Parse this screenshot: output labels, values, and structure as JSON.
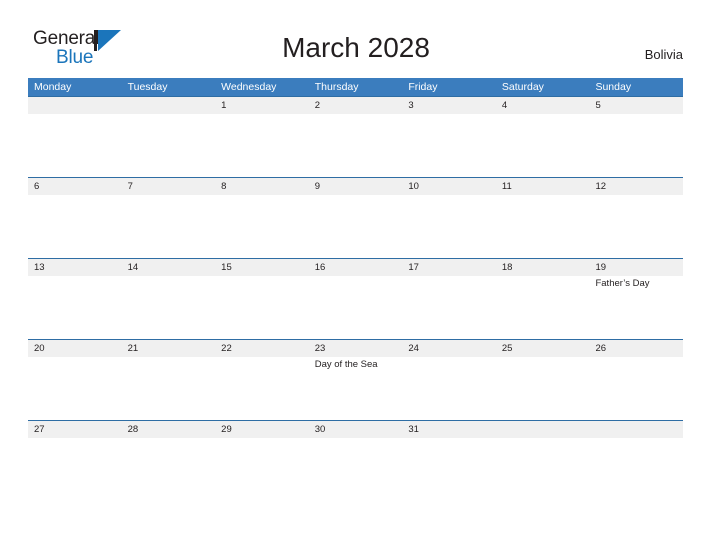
{
  "brand": {
    "word1": "General",
    "word2": "Blue",
    "logo_icon": "general-blue-triangle-logo",
    "accent_color": "#1b75bb",
    "text_color": "#231f20"
  },
  "header": {
    "title": "March 2028",
    "region": "Bolivia"
  },
  "calendar": {
    "header_bg_color": "#3b7dbe",
    "band_color": "#f0f0f0",
    "row_border_color": "#2e6da4",
    "weekdays": [
      "Monday",
      "Tuesday",
      "Wednesday",
      "Thursday",
      "Friday",
      "Saturday",
      "Sunday"
    ],
    "weeks": [
      [
        {
          "day": ""
        },
        {
          "day": ""
        },
        {
          "day": "1"
        },
        {
          "day": "2"
        },
        {
          "day": "3"
        },
        {
          "day": "4"
        },
        {
          "day": "5"
        }
      ],
      [
        {
          "day": "6"
        },
        {
          "day": "7"
        },
        {
          "day": "8"
        },
        {
          "day": "9"
        },
        {
          "day": "10"
        },
        {
          "day": "11"
        },
        {
          "day": "12"
        }
      ],
      [
        {
          "day": "13"
        },
        {
          "day": "14"
        },
        {
          "day": "15"
        },
        {
          "day": "16"
        },
        {
          "day": "17"
        },
        {
          "day": "18"
        },
        {
          "day": "19",
          "event": "Father’s Day"
        }
      ],
      [
        {
          "day": "20"
        },
        {
          "day": "21"
        },
        {
          "day": "22"
        },
        {
          "day": "23",
          "event": "Day of the Sea"
        },
        {
          "day": "24"
        },
        {
          "day": "25"
        },
        {
          "day": "26"
        }
      ],
      [
        {
          "day": "27"
        },
        {
          "day": "28"
        },
        {
          "day": "29"
        },
        {
          "day": "30"
        },
        {
          "day": "31"
        },
        {
          "day": ""
        },
        {
          "day": ""
        }
      ]
    ]
  }
}
